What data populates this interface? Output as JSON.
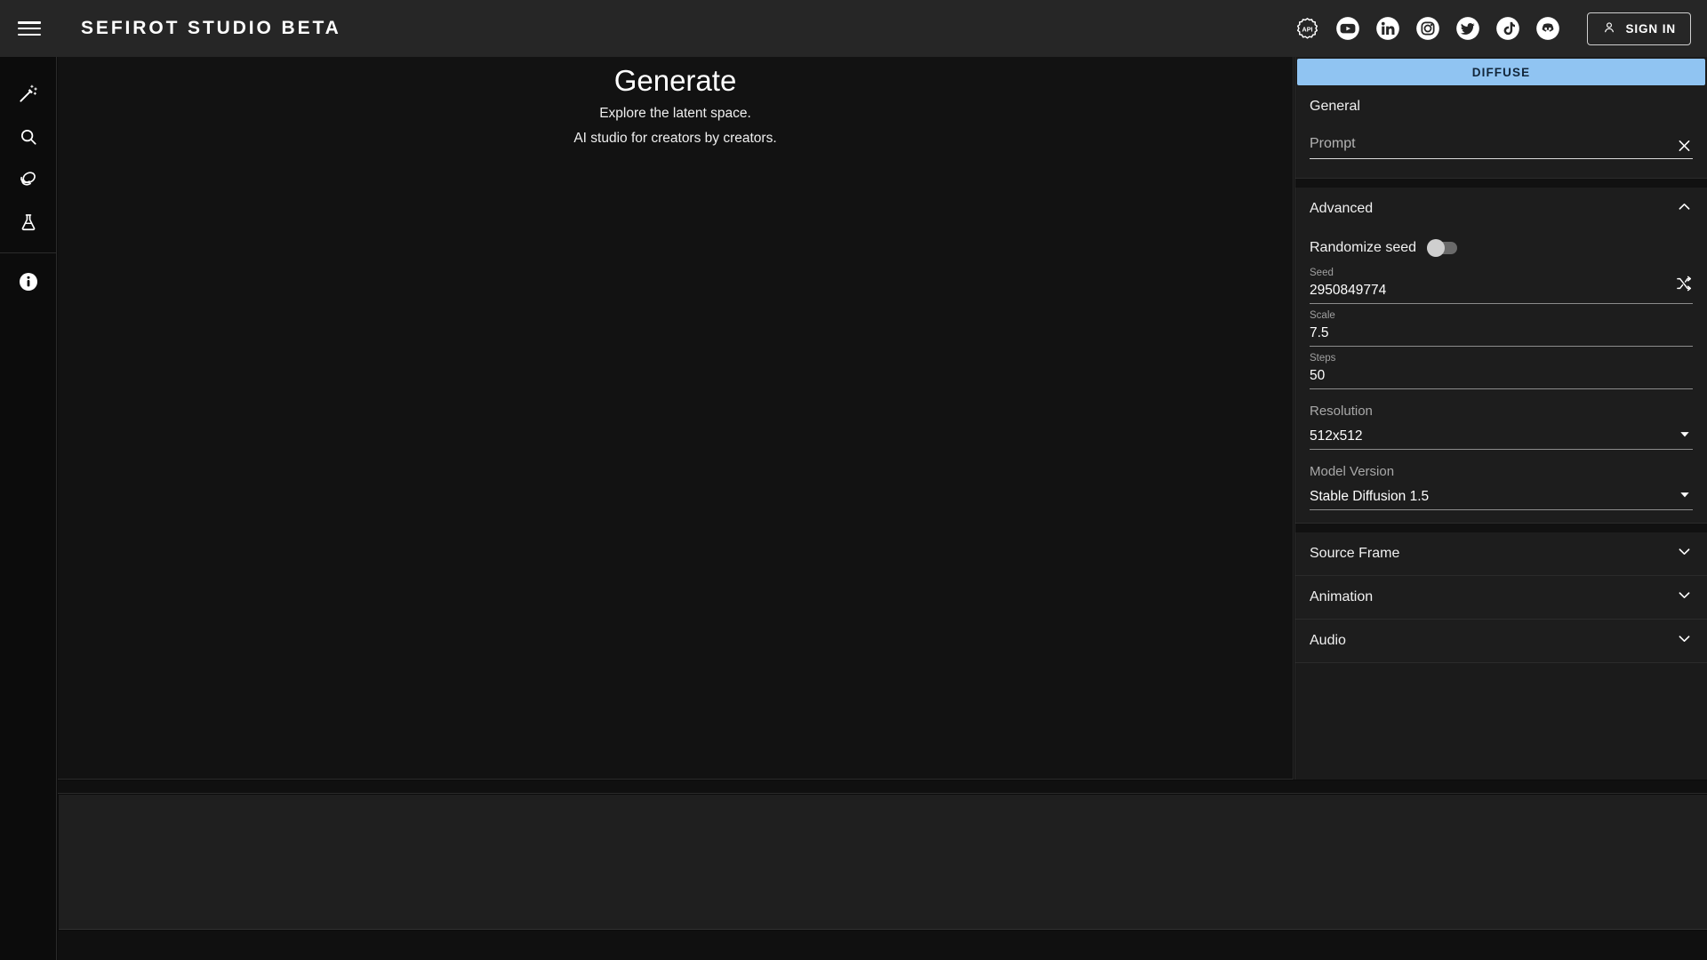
{
  "topbar": {
    "menu_icon": "hamburger-menu-icon",
    "brand": "SEFIROT STUDIO BETA",
    "socials": [
      {
        "name": "api-icon",
        "label": "API"
      },
      {
        "name": "youtube-icon",
        "label": "YouTube"
      },
      {
        "name": "linkedin-icon",
        "label": "LinkedIn"
      },
      {
        "name": "instagram-icon",
        "label": "Instagram"
      },
      {
        "name": "twitter-icon",
        "label": "Twitter"
      },
      {
        "name": "tiktok-icon",
        "label": "TikTok"
      },
      {
        "name": "discord-icon",
        "label": "Discord"
      }
    ],
    "sign_in_label": "SIGN IN",
    "sign_in_icon": "person-icon"
  },
  "sidebar": {
    "items": [
      {
        "name": "magic-wand-icon",
        "label": "Generate"
      },
      {
        "name": "search-icon",
        "label": "Search"
      },
      {
        "name": "layers-icon",
        "label": "Layers"
      },
      {
        "name": "flask-icon",
        "label": "Lab"
      }
    ],
    "info": {
      "name": "info-icon",
      "label": "Info"
    }
  },
  "hero": {
    "title": "Generate",
    "subtitle_1": "Explore the latent space.",
    "subtitle_2": "AI studio for creators by creators."
  },
  "panel": {
    "diffuse_label": "DIFFUSE",
    "accent_color": "#90c4f2",
    "general": {
      "title": "General",
      "prompt": {
        "label": "Prompt",
        "placeholder": "Prompt",
        "value": "",
        "clear_icon": "close-icon"
      }
    },
    "advanced": {
      "title": "Advanced",
      "expanded": true,
      "chevron_icon": "chevron-up-icon",
      "randomize_seed": {
        "label": "Randomize seed",
        "enabled": false
      },
      "seed": {
        "label": "Seed",
        "value": "2950849774",
        "action_icon": "shuffle-icon"
      },
      "scale": {
        "label": "Scale",
        "value": "7.5"
      },
      "steps": {
        "label": "Steps",
        "value": "50"
      },
      "resolution": {
        "label": "Resolution",
        "value": "512x512",
        "caret_icon": "caret-down-icon"
      },
      "model_version": {
        "label": "Model Version",
        "value": "Stable Diffusion 1.5",
        "caret_icon": "caret-down-icon"
      }
    },
    "collapsed_sections": [
      {
        "title": "Source Frame",
        "chevron_icon": "chevron-down-icon"
      },
      {
        "title": "Animation",
        "chevron_icon": "chevron-down-icon"
      },
      {
        "title": "Audio",
        "chevron_icon": "chevron-down-icon"
      }
    ]
  }
}
